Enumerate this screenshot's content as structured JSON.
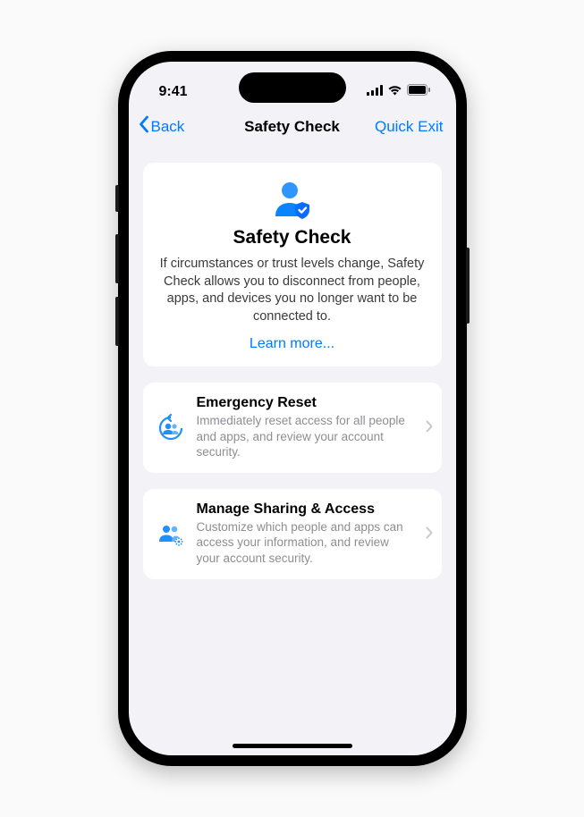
{
  "status": {
    "time": "9:41"
  },
  "nav": {
    "back_label": "Back",
    "title": "Safety Check",
    "exit_label": "Quick Exit"
  },
  "intro": {
    "title": "Safety Check",
    "description": "If circumstances or trust levels change, Safety Check allows you to disconnect from people, apps, and devices you no longer want to be connected to.",
    "learn_more": "Learn more..."
  },
  "actions": [
    {
      "title": "Emergency Reset",
      "description": "Immediately reset access for all people and apps, and review your account security."
    },
    {
      "title": "Manage Sharing & Access",
      "description": "Customize which people and apps can access your information, and review your account security."
    }
  ],
  "colors": {
    "accent": "#007aff",
    "iconBlue": "#1e90ff"
  }
}
